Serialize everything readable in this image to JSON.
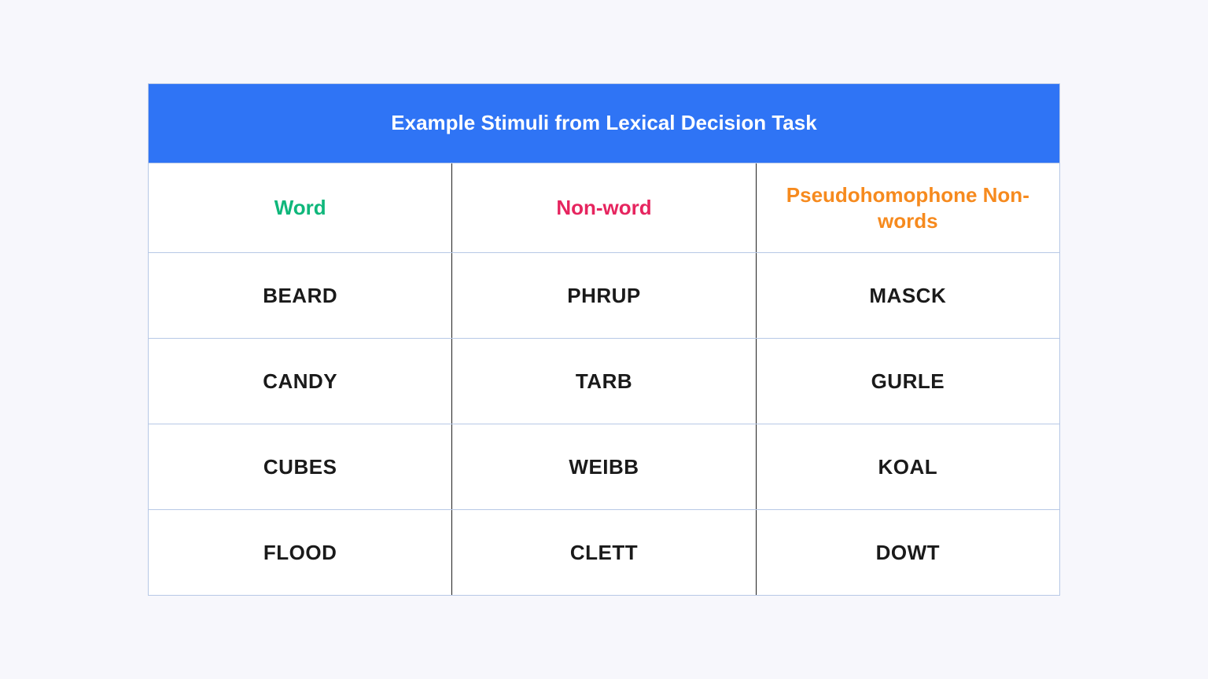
{
  "title": "Example Stimuli from Lexical Decision Task",
  "headers": {
    "word": "Word",
    "nonword": "Non-word",
    "pseudo": "Pseudohomophone Non-words"
  },
  "rows": [
    {
      "word": "BEARD",
      "nonword": "PHRUP",
      "pseudo": "MASCK"
    },
    {
      "word": "CANDY",
      "nonword": "TARB",
      "pseudo": "GURLE"
    },
    {
      "word": "CUBES",
      "nonword": "WEIBB",
      "pseudo": "KOAL"
    },
    {
      "word": "FLOOD",
      "nonword": "CLETT",
      "pseudo": "DOWT"
    }
  ],
  "colors": {
    "titleBg": "#2f74f5",
    "word": "#0fb77b",
    "nonword": "#e6255f",
    "pseudo": "#f68a1e",
    "border": "#b7c8e6"
  },
  "chart_data": {
    "type": "table",
    "title": "Example Stimuli from Lexical Decision Task",
    "columns": [
      "Word",
      "Non-word",
      "Pseudohomophone Non-words"
    ],
    "rows": [
      [
        "BEARD",
        "PHRUP",
        "MASCK"
      ],
      [
        "CANDY",
        "TARB",
        "GURLE"
      ],
      [
        "CUBES",
        "WEIBB",
        "KOAL"
      ],
      [
        "FLOOD",
        "CLETT",
        "DOWT"
      ]
    ]
  }
}
